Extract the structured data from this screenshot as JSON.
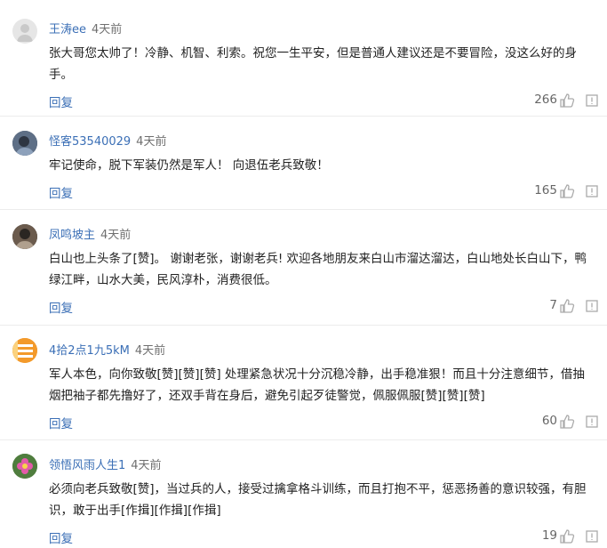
{
  "comments": [
    {
      "user": "王涛ee",
      "time": "4天前",
      "text": "张大哥您太帅了！冷静、机智、利索。祝您一生平安，但是普通人建议还是不要冒险，没这么好的身手。",
      "reply_label": "回复",
      "likes": "266",
      "avatar_icon": "default-avatar-icon"
    },
    {
      "user": "怪客53540029",
      "time": "4天前",
      "text": "牢记使命，脱下军装仍然是军人！ 向退伍老兵致敬！",
      "reply_label": "回复",
      "likes": "165",
      "avatar_icon": "photo-avatar-icon"
    },
    {
      "user": "凤鸣坡主",
      "time": "4天前",
      "text": "白山也上头条了[赞]。 谢谢老张，谢谢老兵! 欢迎各地朋友来白山市溜达溜达，白山地处长白山下，鸭绿江畔，山水大美，民风淳朴，消费很低。",
      "reply_label": "回复",
      "likes": "7",
      "avatar_icon": "photo-avatar-icon"
    },
    {
      "user": "4拾2点1九5kM",
      "time": "4天前",
      "text": "军人本色，向你致敬[赞][赞][赞] 处理紧急状况十分沉稳冷静，出手稳准狠！而且十分注意细节，借抽烟把袖子都先撸好了，还双手背在身后，避免引起歹徒警觉，佩服佩服[赞][赞][赞]",
      "reply_label": "回复",
      "likes": "60",
      "avatar_icon": "calculator-avatar-icon"
    },
    {
      "user": "领悟风雨人生1",
      "time": "4天前",
      "text": "必须向老兵致敬[赞]，当过兵的人，接受过擒拿格斗训练，而且打抱不平，惩恶扬善的意识较强，有胆识，敢于出手[作揖][作揖][作揖]",
      "reply_label": "回复",
      "likes": "19",
      "avatar_icon": "flower-avatar-icon"
    }
  ],
  "colors": {
    "link": "#3b6fb6",
    "text": "#222222",
    "muted": "#666666",
    "divider": "#ececec"
  }
}
